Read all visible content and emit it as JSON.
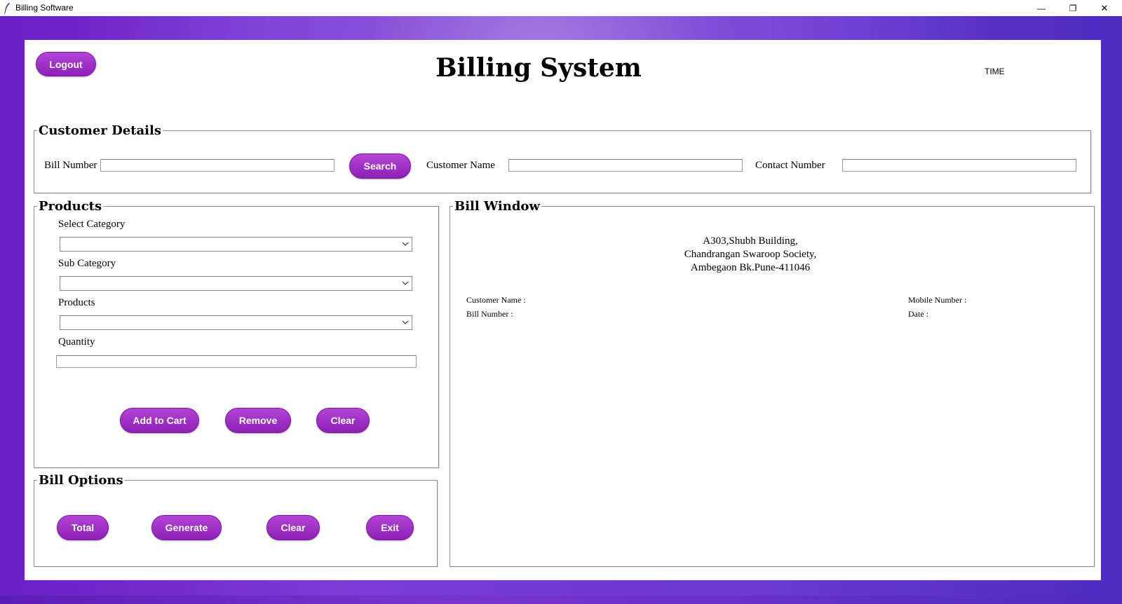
{
  "window": {
    "title": "Billing Software",
    "controls": {
      "minimize": "—",
      "maximize": "❐",
      "close": "✕"
    }
  },
  "header": {
    "logout_label": "Logout",
    "title": "Billing System",
    "time_label": "TIME"
  },
  "customer_details": {
    "legend": "Customer Details",
    "bill_number_label": "Bill Number",
    "bill_number_value": "",
    "search_label": "Search",
    "customer_name_label": "Customer Name",
    "customer_name_value": "",
    "contact_number_label": "Contact Number",
    "contact_number_value": ""
  },
  "products": {
    "legend": "Products",
    "select_category_label": "Select Category",
    "select_category_value": "",
    "sub_category_label": "Sub Category",
    "sub_category_value": "",
    "products_label": "Products",
    "products_value": "",
    "quantity_label": "Quantity",
    "quantity_value": "",
    "add_to_cart_label": "Add to Cart",
    "remove_label": "Remove",
    "clear_label": "Clear"
  },
  "bill_options": {
    "legend": "Bill Options",
    "total_label": "Total",
    "generate_label": "Generate",
    "clear_label": "Clear",
    "exit_label": "Exit"
  },
  "bill_window": {
    "legend": "Bill Window",
    "address_line1": "A303,Shubh Building,",
    "address_line2": "Chandrangan Swaroop Society,",
    "address_line3": "Ambegaon Bk.Pune-411046",
    "customer_name_label": "Customer Name :",
    "bill_number_label": "Bill Number :",
    "mobile_number_label": "Mobile Number :",
    "date_label": "Date :"
  },
  "colors": {
    "button_gradient_top": "#b445d6",
    "button_gradient_bottom": "#8e1fb8",
    "background_purple": "#6a1fc8"
  }
}
